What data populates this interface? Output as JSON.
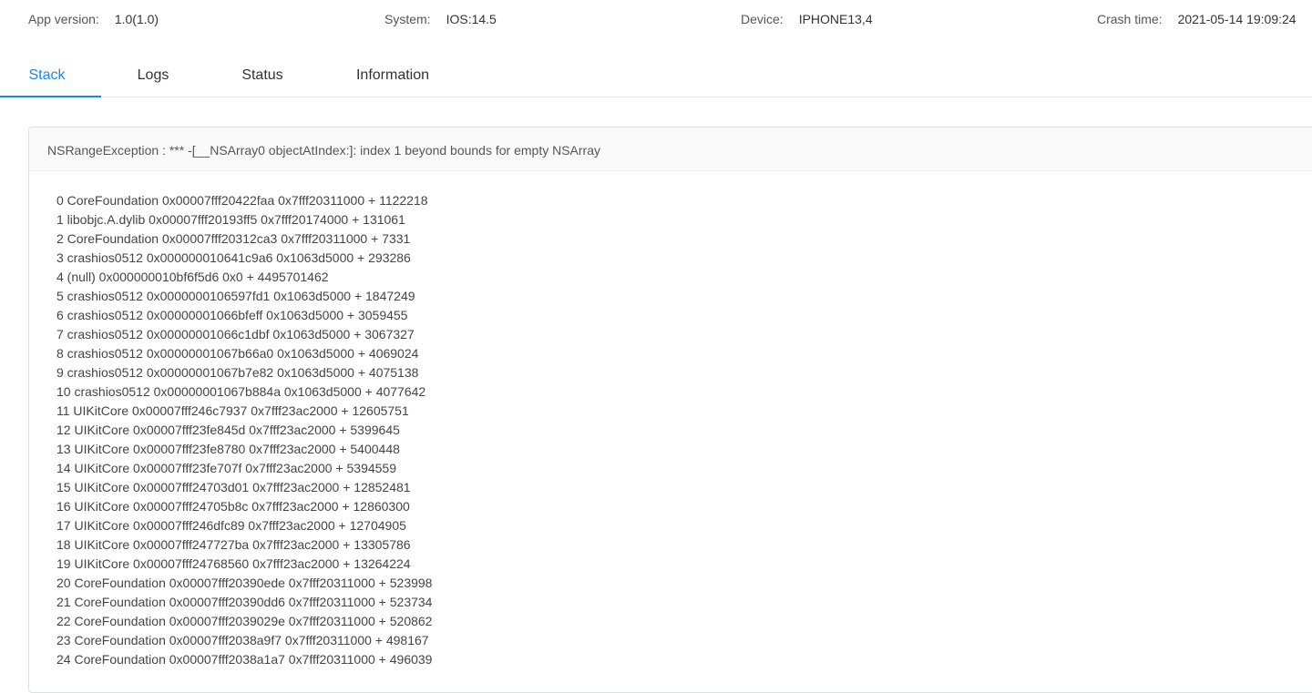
{
  "info": {
    "app_version_label": "App version:",
    "app_version_value": "1.0(1.0)",
    "system_label": "System:",
    "system_value": "IOS:14.5",
    "device_label": "Device:",
    "device_value": "IPHONE13,4",
    "crash_time_label": "Crash time:",
    "crash_time_value": "2021-05-14 19:09:24"
  },
  "tabs": [
    {
      "label": "Stack",
      "active": true
    },
    {
      "label": "Logs",
      "active": false
    },
    {
      "label": "Status",
      "active": false
    },
    {
      "label": "Information",
      "active": false
    }
  ],
  "colors": {
    "accent": "#1a87e8"
  },
  "exception": {
    "title": "NSRangeException : *** -[__NSArray0 objectAtIndex:]: index 1 beyond bounds for empty NSArray"
  },
  "stack": [
    "0 CoreFoundation 0x00007fff20422faa 0x7fff20311000 + 1122218",
    "1 libobjc.A.dylib 0x00007fff20193ff5 0x7fff20174000 + 131061",
    "2 CoreFoundation 0x00007fff20312ca3 0x7fff20311000 + 7331",
    "3 crashios0512 0x000000010641c9a6 0x1063d5000 + 293286",
    "4 (null) 0x000000010bf6f5d6 0x0 + 4495701462",
    "5 crashios0512 0x0000000106597fd1 0x1063d5000 + 1847249",
    "6 crashios0512 0x00000001066bfeff 0x1063d5000 + 3059455",
    "7 crashios0512 0x00000001066c1dbf 0x1063d5000 + 3067327",
    "8 crashios0512 0x00000001067b66a0 0x1063d5000 + 4069024",
    "9 crashios0512 0x00000001067b7e82 0x1063d5000 + 4075138",
    "10 crashios0512 0x00000001067b884a 0x1063d5000 + 4077642",
    "11 UIKitCore 0x00007fff246c7937 0x7fff23ac2000 + 12605751",
    "12 UIKitCore 0x00007fff23fe845d 0x7fff23ac2000 + 5399645",
    "13 UIKitCore 0x00007fff23fe8780 0x7fff23ac2000 + 5400448",
    "14 UIKitCore 0x00007fff23fe707f 0x7fff23ac2000 + 5394559",
    "15 UIKitCore 0x00007fff24703d01 0x7fff23ac2000 + 12852481",
    "16 UIKitCore 0x00007fff24705b8c 0x7fff23ac2000 + 12860300",
    "17 UIKitCore 0x00007fff246dfc89 0x7fff23ac2000 + 12704905",
    "18 UIKitCore 0x00007fff247727ba 0x7fff23ac2000 + 13305786",
    "19 UIKitCore 0x00007fff24768560 0x7fff23ac2000 + 13264224",
    "20 CoreFoundation 0x00007fff20390ede 0x7fff20311000 + 523998",
    "21 CoreFoundation 0x00007fff20390dd6 0x7fff20311000 + 523734",
    "22 CoreFoundation 0x00007fff2039029e 0x7fff20311000 + 520862",
    "23 CoreFoundation 0x00007fff2038a9f7 0x7fff20311000 + 498167",
    "24 CoreFoundation 0x00007fff2038a1a7 0x7fff20311000 + 496039"
  ]
}
